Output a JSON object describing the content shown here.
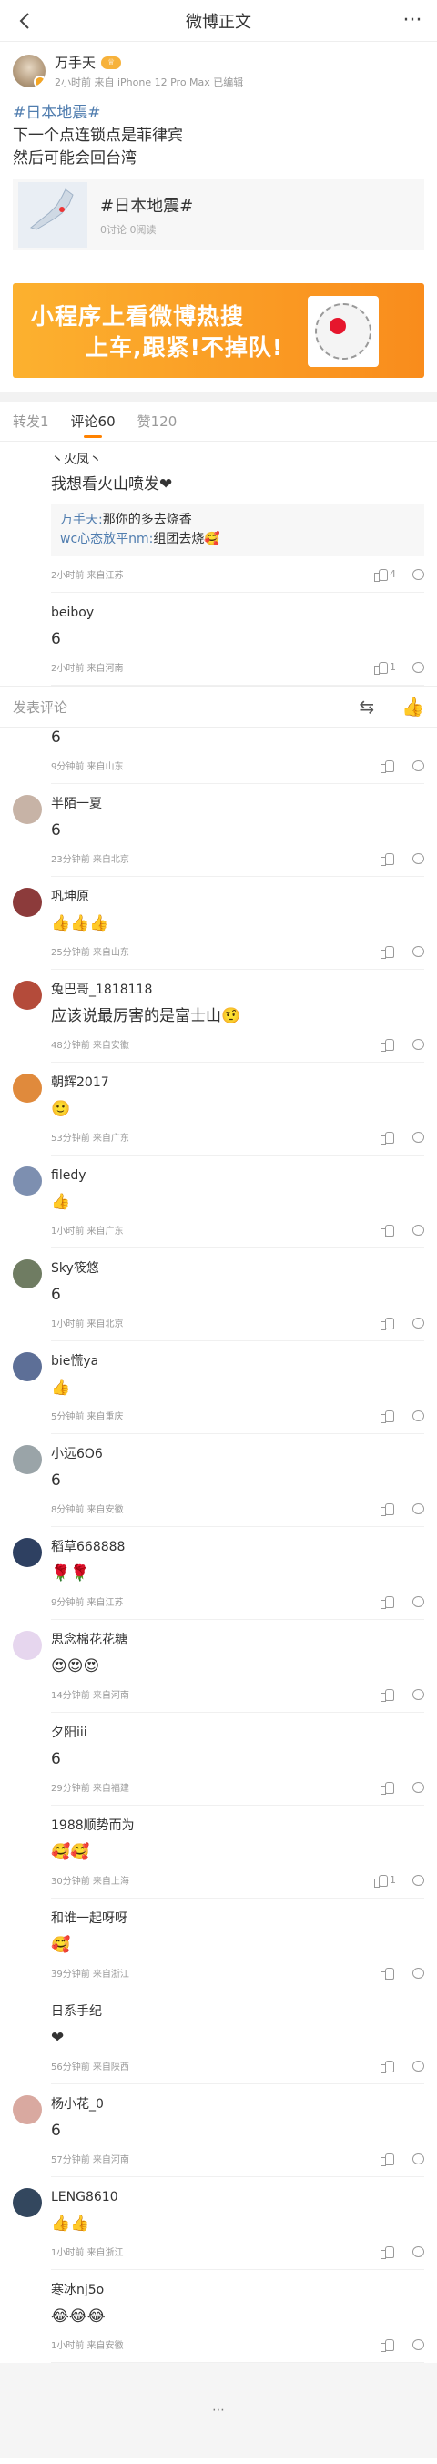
{
  "topbar": {
    "title": "微博正文",
    "back_icon": "chevron-left-icon",
    "more_label": "···"
  },
  "post": {
    "author": "万手天",
    "meta": "2小时前 来自 iPhone 12 Pro Max 已编辑",
    "hashtag": "#日本地震#",
    "line1": "下一个点连锁点是菲律宾",
    "line2": "然后可能会回台湾",
    "topic": {
      "title": "#日本地震#",
      "stat": "0讨论 0阅读"
    }
  },
  "banner": {
    "line1": "小程序上看微博热搜",
    "line2": "上车,跟紧!不掉队!"
  },
  "tabs": [
    {
      "label": "转发1"
    },
    {
      "label": "评论60"
    },
    {
      "label": "赞120"
    }
  ],
  "compose": {
    "placeholder": "发表评论"
  },
  "pinned": [
    {
      "name": "丶火凤丶",
      "text": "我想看火山喷发❤",
      "reply_user": "万手天:",
      "reply_text": "那你的多去烧香",
      "reply_user2": "wc心态放平nm:",
      "reply_text2": "组团去烧🥰",
      "meta": "2小时前 来自江苏",
      "likes": "4"
    },
    {
      "name": "beiboy",
      "text": "6",
      "meta": "2小时前 来自河南",
      "likes": "1"
    }
  ],
  "comments": [
    {
      "name": "",
      "text": "6",
      "meta": "9分钟前 来自山东",
      "likes": "",
      "color": "#ffffff"
    },
    {
      "name": "半陌一夏",
      "text": "6",
      "meta": "23分钟前 来自北京",
      "likes": "",
      "color": "#c7b3a6"
    },
    {
      "name": "巩坤原",
      "text": "👍👍👍",
      "meta": "25分钟前 来自山东",
      "likes": "",
      "color": "#8c3b3b"
    },
    {
      "name": "兔巴哥_1818118",
      "text": "应该说最厉害的是富士山🤨",
      "meta": "48分钟前 来自安徽",
      "likes": "",
      "color": "#b44b3a"
    },
    {
      "name": "朝辉2017",
      "text": "🙂",
      "meta": "53分钟前 来自广东",
      "likes": "",
      "color": "#e08a3c"
    },
    {
      "name": "filedy",
      "text": "👍",
      "meta": "1小时前 来自广东",
      "likes": "",
      "color": "#7d8fb0"
    },
    {
      "name": "Sky筱悠",
      "text": "6",
      "meta": "1小时前 来自北京",
      "likes": "",
      "color": "#6f7c62"
    },
    {
      "name": "bie慌ya",
      "text": "👍",
      "meta": "5分钟前 来自重庆",
      "likes": "",
      "color": "#5d6f97"
    },
    {
      "name": "小远6O6",
      "text": "6",
      "meta": "8分钟前 来自安徽",
      "likes": "",
      "color": "#9aa4a8"
    },
    {
      "name": "稻草668888",
      "text": "🌹🌹",
      "meta": "9分钟前 来自江苏",
      "likes": "",
      "color": "#2e4061"
    },
    {
      "name": "思念棉花花糖",
      "text": "😍😍😍",
      "meta": "14分钟前 来自河南",
      "likes": "",
      "color": "#e6d6ee"
    },
    {
      "name": "夕阳iii",
      "text": "6",
      "meta": "29分钟前 来自福建",
      "likes": "",
      "color": "#ffffff"
    },
    {
      "name": "1988顺势而为",
      "text": "🥰🥰",
      "meta": "30分钟前 来自上海",
      "likes": "1",
      "color": "#ffffff"
    },
    {
      "name": "和谁一起呀呀",
      "text": "🥰",
      "meta": "39分钟前 来自浙江",
      "likes": "",
      "color": "#ffffff"
    },
    {
      "name": "日系手纪",
      "text": "❤",
      "meta": "56分钟前 来自陕西",
      "likes": "",
      "color": "#ffffff"
    },
    {
      "name": "杨小花_0",
      "text": "6",
      "meta": "57分钟前 来自河南",
      "likes": "",
      "color": "#d9a9a0"
    },
    {
      "name": "LENG8610",
      "text": "👍👍",
      "meta": "1小时前 来自浙江",
      "likes": "",
      "color": "#33475e"
    },
    {
      "name": "寒冰nj5o",
      "text": "😂😂😂",
      "meta": "1小时前 来自安徽",
      "likes": "",
      "color": "#ffffff"
    }
  ]
}
